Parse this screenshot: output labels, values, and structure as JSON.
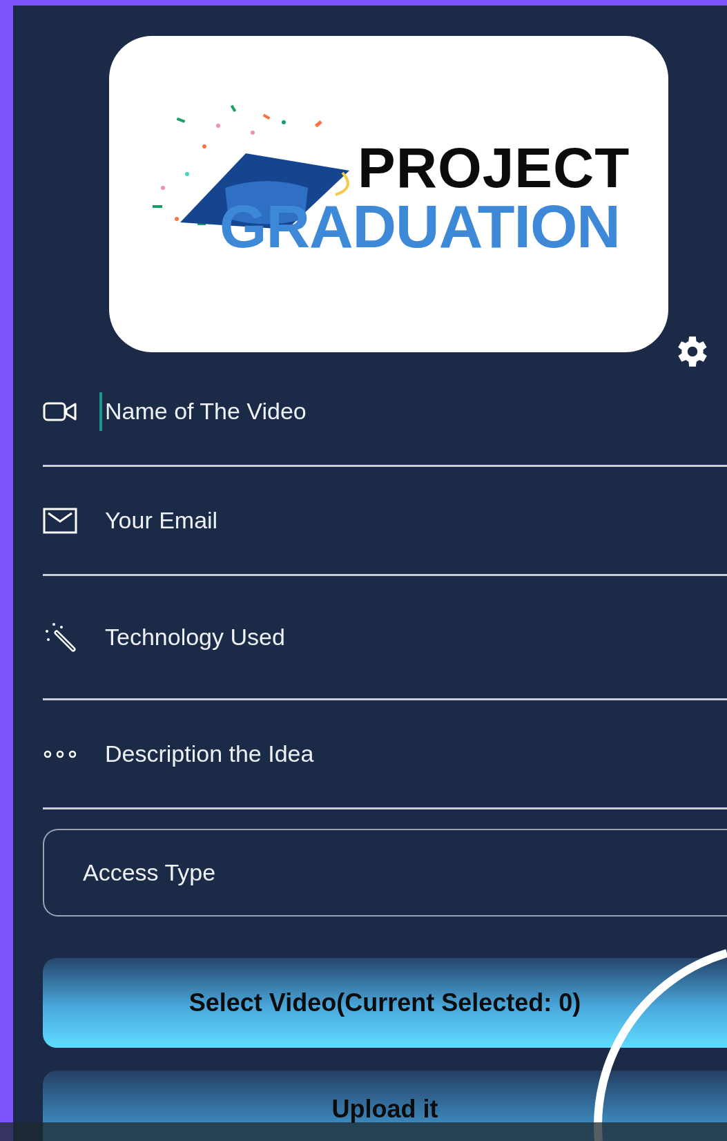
{
  "logo": {
    "line_1": "PROJECT",
    "line_2": "GRADUATION"
  },
  "fields": [
    {
      "kind": "video",
      "placeholder": "Name of The Video",
      "focused": true
    },
    {
      "kind": "email",
      "placeholder": "Your Email",
      "focused": false
    },
    {
      "kind": "wand",
      "placeholder": "Technology Used",
      "focused": false
    },
    {
      "kind": "dots",
      "placeholder": "Description the Idea",
      "focused": false
    }
  ],
  "access_type": {
    "placeholder": "Access Type"
  },
  "buttons": [
    "Select Video(Current Selected: 0)",
    "Upload it"
  ]
}
